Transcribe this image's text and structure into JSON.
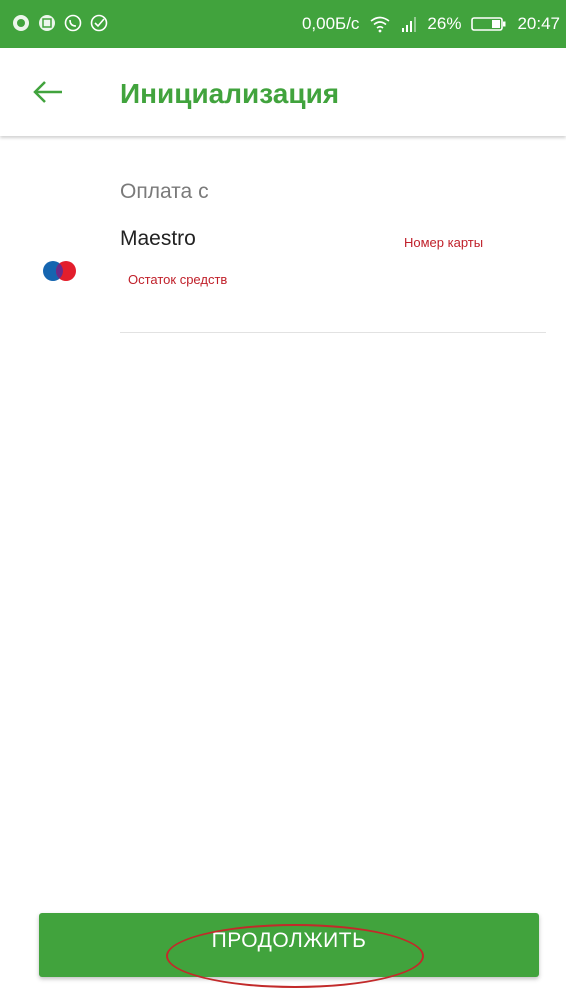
{
  "status_bar": {
    "speed": "0,00Б/с",
    "battery_percent": "26%",
    "time": "20:47",
    "icons": [
      "app-dot-icon",
      "gallery-icon",
      "whatsapp-icon",
      "sberbank-icon",
      "wifi-icon",
      "signal-icon",
      "battery-icon"
    ]
  },
  "header": {
    "title": "Инициализация",
    "back_icon": "arrow-left-icon"
  },
  "payment": {
    "from_label": "Оплата с",
    "card_name": "Maestro",
    "card_number_label": "Номер карты",
    "balance_label": "Остаток средств",
    "card_icon": "maestro-logo-icon"
  },
  "footer": {
    "continue_label": "ПРОДОЛЖИТЬ"
  },
  "colors": {
    "brand_green": "#41a33d",
    "accent_red": "#c0202a",
    "annotation_red": "#c22a2a"
  }
}
